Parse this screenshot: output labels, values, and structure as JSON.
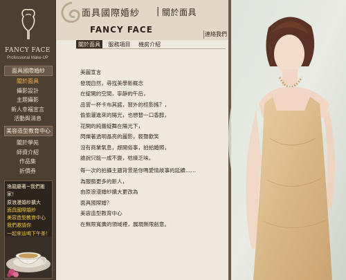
{
  "brand": {
    "name": "FANCY FACE",
    "tagline": "Professional Make-UP"
  },
  "sidebar": {
    "section1": "面具國際婚紗",
    "menu1": [
      "關於面具",
      "攝影設計",
      "主題攝影",
      "新人幸福宣言",
      "活動與消息"
    ],
    "section2": "美容造型教育中心",
    "menu2": [
      "關於學苑",
      "師資介紹",
      "作品集",
      "折價券"
    ],
    "promo": [
      "逸龍廳著~我們搬家！",
      "原浪漫婚紗擴大",
      "面具國際婚紗",
      "美容造型教育中心",
      "我們邀請你",
      "一起來這喝下午茶！"
    ]
  },
  "header": {
    "title_cn": "面具國際婚紗",
    "separator": "|",
    "about": "關於面具",
    "title_en": "FANCY FACE",
    "contact": "連絡我們"
  },
  "tabs": [
    "關於面具",
    "服務項目",
    "機房介紹"
  ],
  "content": {
    "block1": [
      "美麗宣言",
      "發現自然，尋找美學新概念",
      "在綻開的空間，寧靜的午后，",
      "品嘗一杯卡布其諾，窗外的桂影搖？，",
      "偷偷灑進來的陽光，也想替一口香醇，",
      "花開的純蕾綻舞在陽光下，",
      "閃爍著透明晶亮的麗影，輕聲歡笑",
      "沒有商業氣息，趕開俗事，拍給婚照，",
      "誰說只能一成不變，枯燥乏味。"
    ],
    "block2": [
      "每一次的拍攝主題背景是你嗎愛情故事的延續……",
      "為服務更多的新人，",
      "由原浪漫婚紗擴大更改為",
      "面具國際婚？",
      "美容造型教育中心",
      "在無限寬廣的領域裡，展現無限創意。"
    ]
  },
  "colors": {
    "sidebar": "#4e3f33",
    "accent": "#f0b24a",
    "promo_highlight": "#f1c640",
    "paper": "#efe8dc"
  }
}
